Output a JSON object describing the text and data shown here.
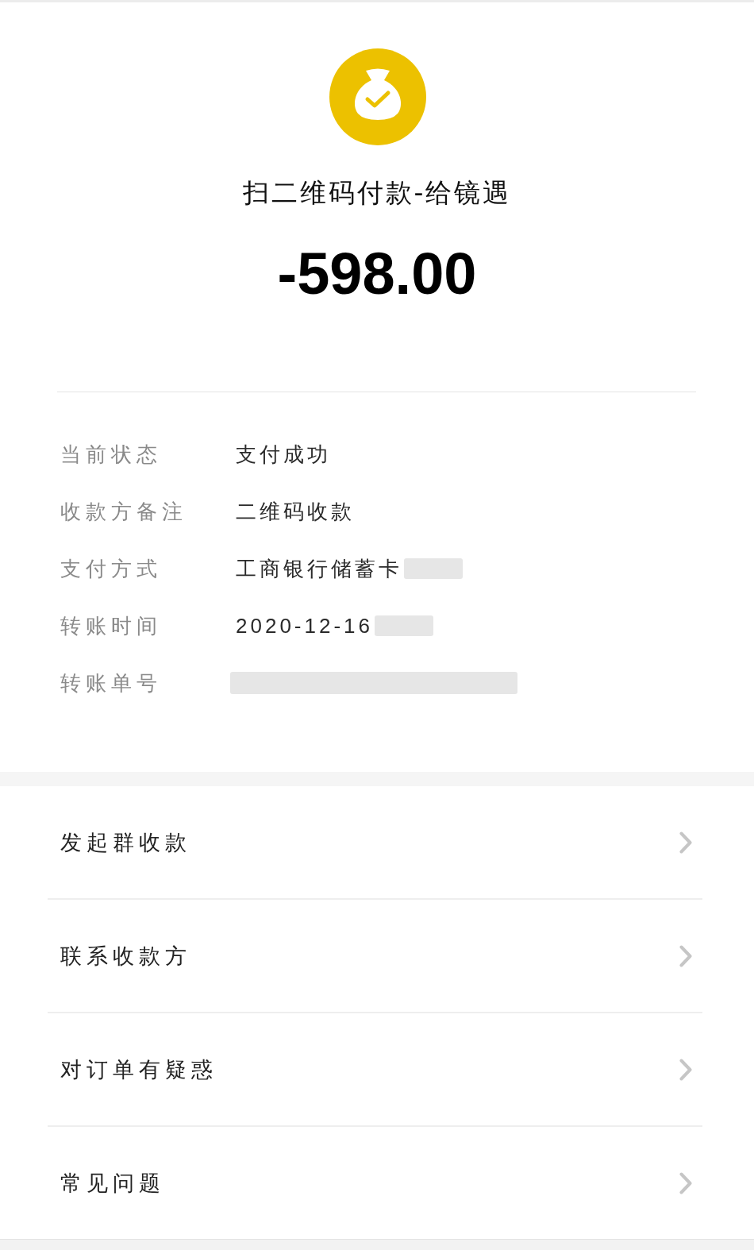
{
  "header": {
    "title": "扫二维码付款-给镜遇",
    "amount": "-598.00"
  },
  "details": [
    {
      "label": "当前状态",
      "value": "支付成功",
      "redacted": false
    },
    {
      "label": "收款方备注",
      "value": "二维码收款",
      "redacted": false
    },
    {
      "label": "支付方式",
      "value": "工商银行储蓄卡",
      "redacted": true
    },
    {
      "label": "转账时间",
      "value": "2020-12-16",
      "redacted": true
    },
    {
      "label": "转账单号",
      "redacted": true
    }
  ],
  "actions": [
    {
      "label": "发起群收款"
    },
    {
      "label": "联系收款方"
    },
    {
      "label": "对订单有疑惑"
    },
    {
      "label": "常见问题"
    }
  ]
}
